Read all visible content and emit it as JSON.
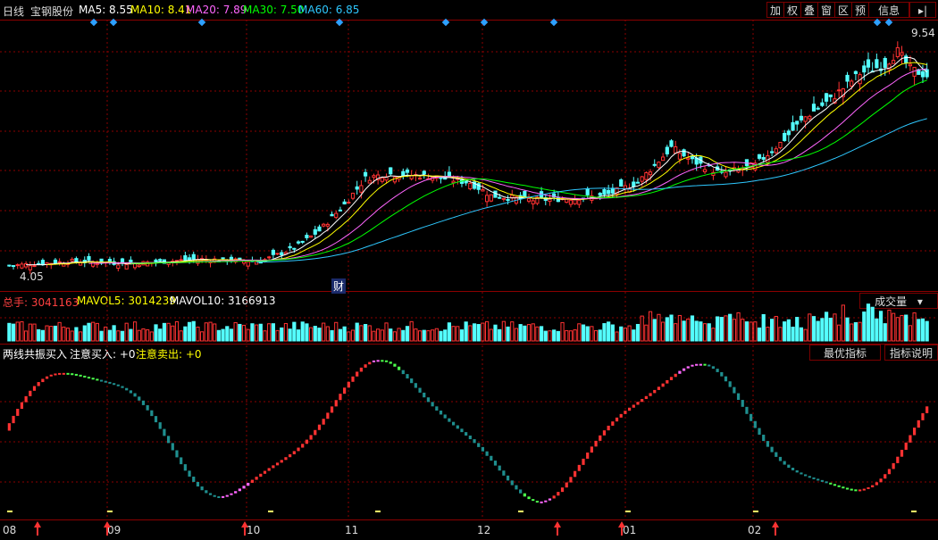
{
  "header": {
    "period": "日线",
    "stock_name": "宝钢股份",
    "ma5_label": "MA5: 8.55",
    "ma10_label": "MA10: 8.41",
    "ma20_label": "MA20: 7.89",
    "ma30_label": "MA30: 7.50",
    "ma60_label": "MA60: 6.85"
  },
  "toolbar": {
    "add": "加",
    "overlay": "叠",
    "window": "窗",
    "range": "区",
    "forecast": "预",
    "info": "信息",
    "exit": "▸|",
    "rights": "权"
  },
  "price_panel": {
    "high_label": "9.54",
    "low_label": "4.05",
    "finance_marker": "财"
  },
  "volume_panel": {
    "total_label": "总手: 3041163",
    "mavol5_label": "MAVOL5: 3014239",
    "mavol10_label": "MAVOL10: 3166913",
    "tab_label": "成交量"
  },
  "indicator_panel": {
    "name": "两线共振买入",
    "buy_label": "注意买入: +0",
    "sell_label": "注意卖出: +0",
    "tab_best": "最优指标",
    "tab_help": "指标说明"
  },
  "x_axis": {
    "ticks": [
      "08",
      "09",
      "10",
      "11",
      "12",
      "01",
      "02"
    ]
  },
  "colors": {
    "up": "#ff3232",
    "down": "#54ffff",
    "ma5": "#ffffff",
    "ma10": "#ffff00",
    "ma20": "#ff66ff",
    "ma30": "#00ff00",
    "ma60": "#2ec8ff",
    "grid": "#8b0000"
  },
  "chart_data": {
    "type": "candlestick",
    "title": "宝钢股份",
    "period": "日线",
    "price_range": [
      4.05,
      9.54
    ],
    "ma_last": {
      "MA5": 8.55,
      "MA10": 8.41,
      "MA20": 7.89,
      "MA30": 7.5,
      "MA60": 6.85
    },
    "close_path": [
      {
        "i": 0,
        "close": 4.2
      },
      {
        "i": 15,
        "close": 4.3
      },
      {
        "i": 30,
        "close": 4.25
      },
      {
        "i": 45,
        "close": 4.35
      },
      {
        "i": 60,
        "close": 4.3
      },
      {
        "i": 68,
        "close": 4.6
      },
      {
        "i": 74,
        "close": 5.0
      },
      {
        "i": 80,
        "close": 5.6
      },
      {
        "i": 85,
        "close": 6.2
      },
      {
        "i": 90,
        "close": 6.3
      },
      {
        "i": 100,
        "close": 6.25
      },
      {
        "i": 110,
        "close": 6.1
      },
      {
        "i": 115,
        "close": 5.8
      },
      {
        "i": 125,
        "close": 5.7
      },
      {
        "i": 135,
        "close": 5.75
      },
      {
        "i": 142,
        "close": 5.8
      },
      {
        "i": 150,
        "close": 6.1
      },
      {
        "i": 158,
        "close": 6.9
      },
      {
        "i": 163,
        "close": 6.6
      },
      {
        "i": 170,
        "close": 6.3
      },
      {
        "i": 178,
        "close": 6.5
      },
      {
        "i": 184,
        "close": 7.0
      },
      {
        "i": 190,
        "close": 7.6
      },
      {
        "i": 196,
        "close": 8.0
      },
      {
        "i": 203,
        "close": 8.6
      },
      {
        "i": 209,
        "close": 8.8
      },
      {
        "i": 212,
        "close": 9.1
      },
      {
        "i": 215,
        "close": 8.7
      },
      {
        "i": 219,
        "close": 8.55
      }
    ],
    "volume": {
      "total": 3041163,
      "MAVOL5": 3014239,
      "MAVOL10": 3166913
    },
    "indicator": {
      "name": "两线共振买入",
      "注意买入": 0,
      "注意卖出": 0
    },
    "x_ticks": [
      "08",
      "09",
      "10",
      "11",
      "12",
      "01",
      "02"
    ]
  }
}
